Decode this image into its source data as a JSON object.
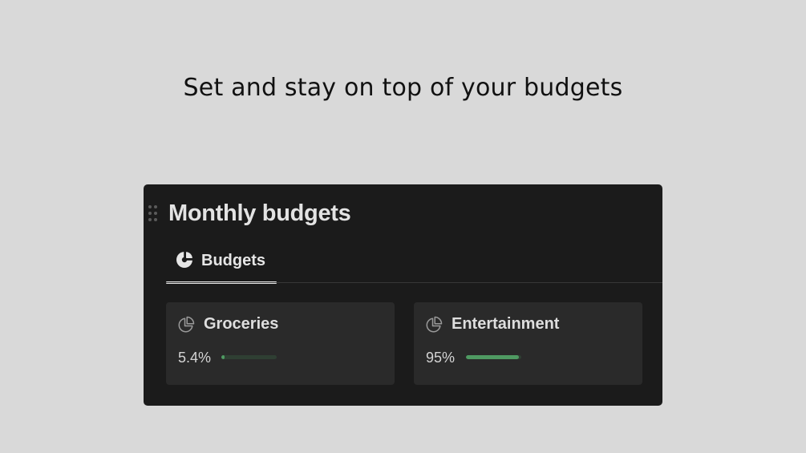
{
  "headline": "Set and stay on top of your budgets",
  "page": {
    "title": "Monthly budgets"
  },
  "tabs": [
    {
      "label": "Budgets",
      "icon": "pie-chart-icon",
      "active": true
    }
  ],
  "budgets": [
    {
      "name": "Groceries",
      "percent_label": "5.4%",
      "progress": 0.054,
      "icon": "pie-chart-outline-icon"
    },
    {
      "name": "Entertainment",
      "percent_label": "95%",
      "progress": 0.95,
      "icon": "pie-chart-outline-icon"
    }
  ],
  "colors": {
    "background": "#d9d9d9",
    "panel": "#1b1b1b",
    "card": "#2a2a2a",
    "progress_fill": "#4f9a62",
    "progress_track": "#2f3f33"
  }
}
